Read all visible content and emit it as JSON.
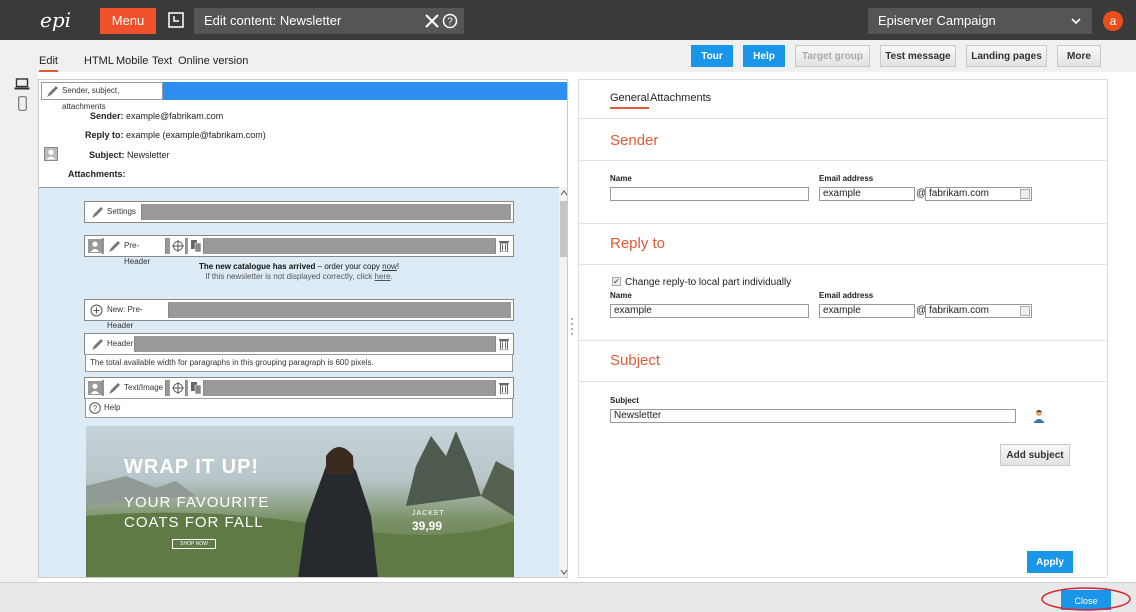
{
  "topbar": {
    "logo": "epi",
    "menu_label": "Menu",
    "tab_title": "Edit content: Newsletter",
    "campaign_name": "Episerver Campaign",
    "avatar_letter": "a"
  },
  "subbar": {
    "tabs": [
      "Edit",
      "HTML",
      "Mobile",
      "Text",
      "Online version"
    ],
    "buttons": {
      "tour": "Tour",
      "help": "Help",
      "target_group": "Target group",
      "test_message": "Test message",
      "landing_pages": "Landing pages",
      "more": "More"
    }
  },
  "header_block": {
    "bar_label": "Sender, subject, attachments",
    "sender_label": "Sender:",
    "sender_value": "example@fabrikam.com",
    "reply_label": "Reply to:",
    "reply_value": "example (example@fabrikam.com)",
    "subject_label": "Subject:",
    "subject_value": "Newsletter",
    "attachments_label": "Attachments:"
  },
  "canvas": {
    "settings_label": "Settings",
    "preheader_label": "Pre-Header",
    "preheader_text_bold": "The new catalogue has arrived",
    "preheader_text_rest": " – order your copy ",
    "preheader_link": "now",
    "preheader_text_end": "!",
    "preheader_line2": "If this newsletter is not displayed correctly, click ",
    "preheader_line2_link": "here",
    "preheader_line2_end": ".",
    "new_preheader_label": "New: Pre-Header",
    "header_label": "Header",
    "header_text": "The total available width for paragraphs in this grouping paragraph is 600 pixels.",
    "textimage_label": "Text/Image",
    "help_label": "Help"
  },
  "banner": {
    "headline": "WRAP IT UP!",
    "line1": "YOUR FAVOURITE",
    "line2": "COATS FOR FALL",
    "shop_now": "SHOP NOW",
    "jacket_label": "JACKET",
    "jacket_price": "39,99"
  },
  "right_panel": {
    "tabs": [
      "General",
      "Attachments"
    ],
    "sender_title": "Sender",
    "name_label": "Name",
    "email_label": "Email address",
    "sender_name_value": "",
    "sender_email_local": "example",
    "at": "@",
    "domain": "fabrikam.com",
    "reply_title": "Reply to",
    "reply_checkbox_label": "Change reply-to local part individually",
    "reply_name_value": "example",
    "reply_email_local": "example",
    "subject_title": "Subject",
    "subject_label": "Subject",
    "subject_value": "Newsletter",
    "add_subject": "Add subject",
    "apply": "Apply"
  },
  "bottombar": {
    "close": "Close"
  },
  "colors": {
    "accent_orange": "#f0502a",
    "accent_blue": "#1a96e8",
    "section_title": "#e05a3a",
    "highlight_circle": "#d9262c"
  },
  "icons": [
    "newwindow-icon",
    "close-icon",
    "help-circle-icon",
    "chevron-down-icon",
    "laptop-icon",
    "phone-icon",
    "pencil-icon",
    "user-icon",
    "crosshair-icon",
    "copy-icon",
    "trash-icon",
    "plus-circle-icon",
    "question-circle-icon",
    "person-icon"
  ]
}
